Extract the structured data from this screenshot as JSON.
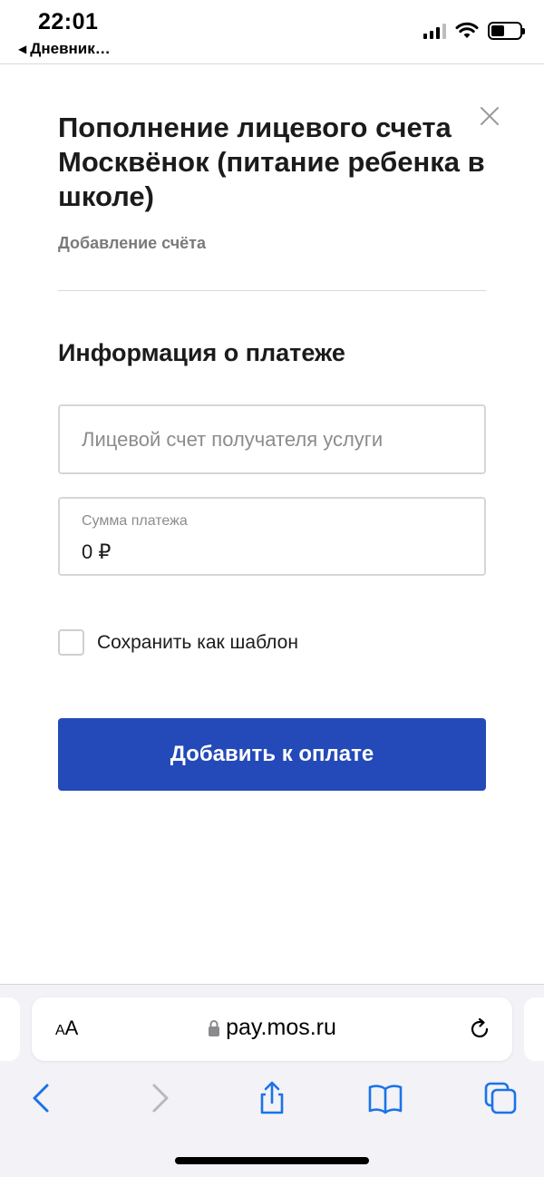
{
  "status_bar": {
    "time": "22:01",
    "back_app": "Дневник…",
    "back_arrow": "◀"
  },
  "modal": {
    "title": "Пополнение лицевого счета Москвёнок (питание ребенка в школе)",
    "subtitle": "Добавление счёта",
    "close_icon": "close-icon",
    "section_title": "Информация о платеже",
    "account_field": {
      "placeholder": "Лицевой счет получателя услуги",
      "value": ""
    },
    "amount_field": {
      "label": "Сумма платежа",
      "value": "0 ₽"
    },
    "save_template": {
      "label": "Сохранить как шаблон",
      "checked": false
    },
    "submit_label": "Добавить к оплате"
  },
  "browser": {
    "text_size_label_small": "A",
    "text_size_label_large": "A",
    "url": "pay.mos.ru",
    "icons": [
      "lock-icon",
      "reload-icon",
      "back-icon",
      "forward-icon",
      "share-icon",
      "bookmarks-icon",
      "tabs-icon"
    ]
  },
  "colors": {
    "accent": "#2449b9",
    "ios_blue": "#1a73e8",
    "muted_text": "#7a7a7a",
    "border": "#d6d6d6"
  }
}
